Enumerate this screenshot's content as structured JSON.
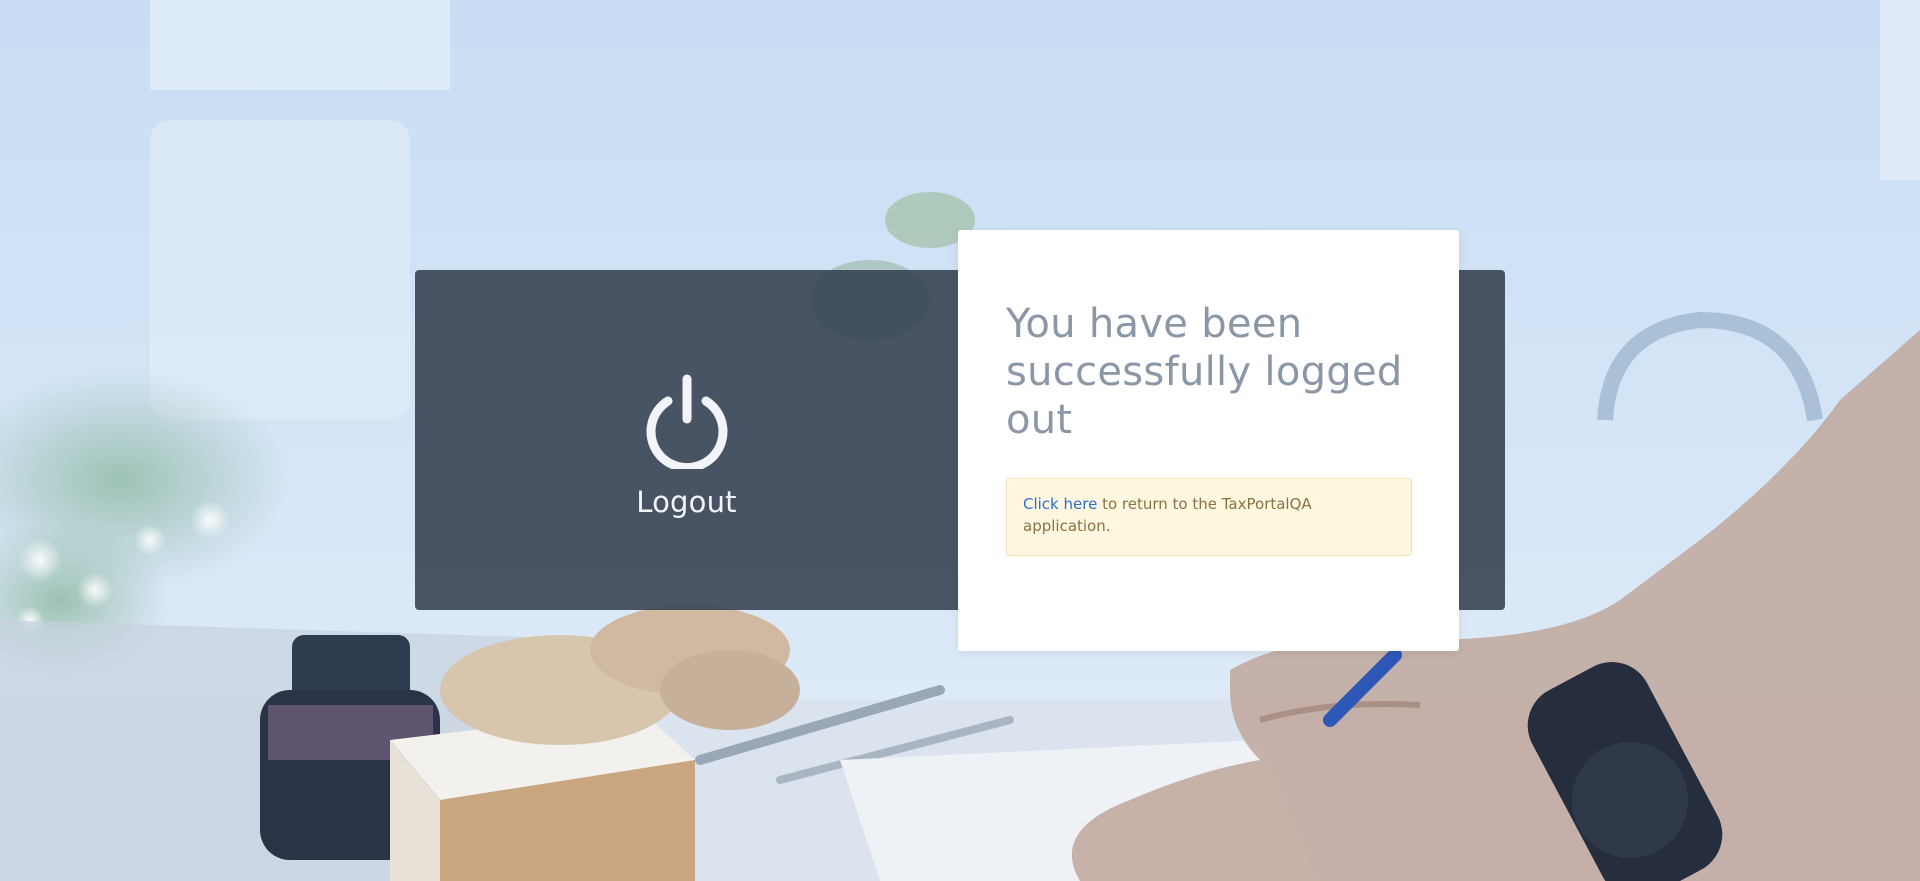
{
  "logout_panel": {
    "icon": "power-icon",
    "label": "Logout"
  },
  "card": {
    "title": "You have been successfully logged out",
    "notice": {
      "link_text": "Click here",
      "message": " to return to the TaxPortalQA application."
    }
  },
  "colors": {
    "panel": "#34404e",
    "card": "#ffffff",
    "title": "#8a97a6",
    "notice_bg": "#fff7df",
    "link": "#2a6fd1",
    "background_tint": "#c9dcf2"
  }
}
